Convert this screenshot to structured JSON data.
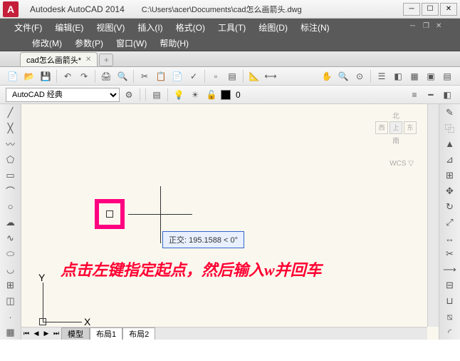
{
  "titlebar": {
    "logo": "A",
    "app_name": "Autodesk AutoCAD 2014",
    "file_path": "C:\\Users\\acer\\Documents\\cad怎么画箭头.dwg"
  },
  "menu": {
    "row1": [
      "文件(F)",
      "编辑(E)",
      "视图(V)",
      "插入(I)",
      "格式(O)",
      "工具(T)",
      "绘图(D)",
      "标注(N)"
    ],
    "row2": [
      "修改(M)",
      "参数(P)",
      "窗口(W)",
      "帮助(H)"
    ]
  },
  "tab": {
    "active": "cad怎么画箭头*"
  },
  "toolbar2": {
    "style": "AutoCAD 经典",
    "layer_zero": "0"
  },
  "canvas": {
    "info_box": "正交: 195.1588 < 0°",
    "annotation": "点击左键指定起点，然后输入w并回车",
    "ucs_x": "X",
    "ucs_y": "Y"
  },
  "compass": {
    "n": "北",
    "w": "西",
    "up": "上",
    "e": "东",
    "s": "南",
    "wcs": "WCS ▽"
  },
  "sheets": {
    "tabs": [
      "模型",
      "布局1",
      "布局2"
    ]
  }
}
